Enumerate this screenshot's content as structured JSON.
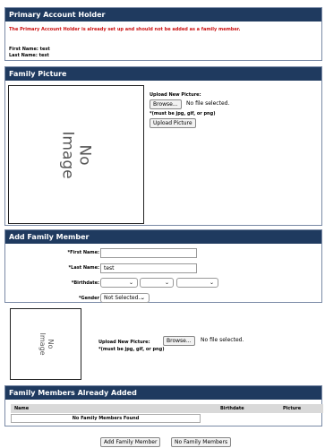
{
  "primary": {
    "header": "Primary Account Holder",
    "warning": "The Primary Account Holder is already set up and should not be added as a family member.",
    "first_name_label": "First Name:",
    "first_name_value": "test",
    "last_name_label": "Last Name:",
    "last_name_value": "test"
  },
  "family_picture": {
    "header": "Family Picture",
    "no_image": "No\nImage",
    "upload_label": "Upload New Picture:",
    "browse": "Browse...",
    "file_status": "No file selected.",
    "hint": "*(must be jpg, gif, or png)",
    "upload_button": "Upload Picture"
  },
  "add_member": {
    "header": "Add Family Member",
    "first_name_label": "*First Name:",
    "first_name_value": "",
    "last_name_label": "*Last Name:",
    "last_name_value": "test",
    "birthdate_label": "*Birthdate:",
    "gender_label": "*Gender",
    "gender_value": "Not Selected...",
    "no_image": "No\nImage",
    "upload_label": "Upload New Picture:",
    "browse": "Browse...",
    "file_status": "No file selected.",
    "hint": "*(must be jpg, gif, or png)"
  },
  "already_added": {
    "header": "Family Members Already Added",
    "columns": [
      "Name",
      "Birthdate",
      "Picture"
    ],
    "empty": "No Family Members Found"
  },
  "footer": {
    "add_button": "Add Family Member",
    "no_members_button": "No Family Members"
  }
}
